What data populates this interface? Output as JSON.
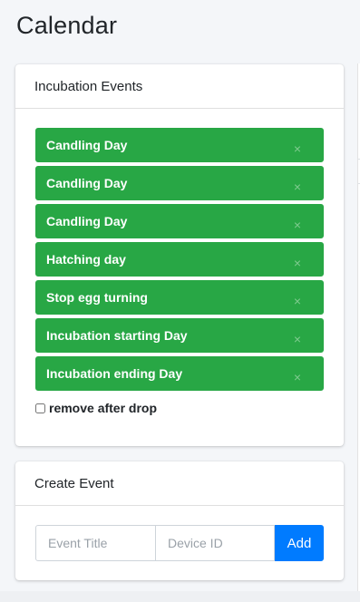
{
  "page": {
    "title": "Calendar"
  },
  "events_card": {
    "header": "Incubation Events",
    "events": [
      {
        "label": "Candling Day",
        "remove": "×"
      },
      {
        "label": "Candling Day",
        "remove": "×"
      },
      {
        "label": "Candling Day",
        "remove": "×"
      },
      {
        "label": "Hatching day",
        "remove": "×"
      },
      {
        "label": "Stop egg turning",
        "remove": "×"
      },
      {
        "label": "Incubation starting Day",
        "remove": "×"
      },
      {
        "label": "Incubation ending Day",
        "remove": "×"
      }
    ],
    "remove_after_drop_label": "remove after drop",
    "remove_after_drop_checked": false,
    "event_color": "#28a745"
  },
  "create_card": {
    "header": "Create Event",
    "title_placeholder": "Event Title",
    "title_value": "",
    "device_placeholder": "Device ID",
    "device_value": "",
    "add_label": "Add",
    "add_color": "#007bff"
  }
}
